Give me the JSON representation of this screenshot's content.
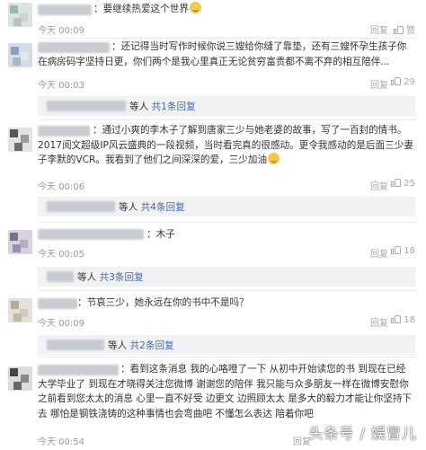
{
  "comments": [
    {
      "text": "：要继续热爱这个世界",
      "time": "今天 00:09",
      "reply_label": "回复",
      "like_count": "赞"
    },
    {
      "text": "：还记得当时写作时候你说三嫂给你缝了靠垫，还有三嫂怀孕生孩子你在病房码字坚持日更，你们两个是我心里真正无论贫穷富贵都不离不弃的相互陪伴...",
      "time": "今天 00:03",
      "reply_label": "回复",
      "like_count": "29",
      "sub_replies_users": "等人",
      "sub_replies_count": "共1条回复"
    },
    {
      "text": "：通过小爽的李木子了解到唐家三少与她老婆的故事，写了一百封的情书。2017阅文超级IP风云盛典的一段视频，当时看完真的很感动。更令我感动的是后面三少妻子李默的VCR。我看到了他们之间深深的爱，三少加油",
      "time": "今天 00:06",
      "reply_label": "回复",
      "like_count": "25",
      "sub_replies_users": "等人",
      "sub_replies_count": "共4条回复"
    },
    {
      "text": "：木子",
      "time": "今天 00:05",
      "reply_label": "回复",
      "like_count": "18",
      "sub_replies_users": "等人",
      "sub_replies_count": "共3条回复"
    },
    {
      "text": "：节哀三少，她永远在你的书中不是吗？",
      "time": "今天 00:09",
      "reply_label": "回复",
      "like_count": "18",
      "sub_replies_users": "等人",
      "sub_replies_count": "共2条回复"
    },
    {
      "text": "：看到这条消息 我的心咯噔了一下 从初中开始读您的书 到现在已经大学毕业了 到现在才晓得关注您微博 谢谢您的陪伴 我只能与众多朋友一样在微博安慰你 之前看到您太太的消息 心里一直不好受 边更文 边照顾太太 是多大的毅力才能让你坚持下去 哪怕是钢铁浇铸的这种事情也会弯曲吧 不懂怎么表达 陪着你吧",
      "time": "今天 00:54",
      "reply_label": "回复"
    }
  ],
  "watermark": "头条号 / 娱冒儿",
  "colors": {
    "link": "#3b6bb6",
    "sub_bg": "#f2f2f5",
    "meta": "#9a9a9a"
  },
  "icons": {
    "like": "thumbs-up-icon",
    "emoji": "smile-emoji-icon"
  }
}
